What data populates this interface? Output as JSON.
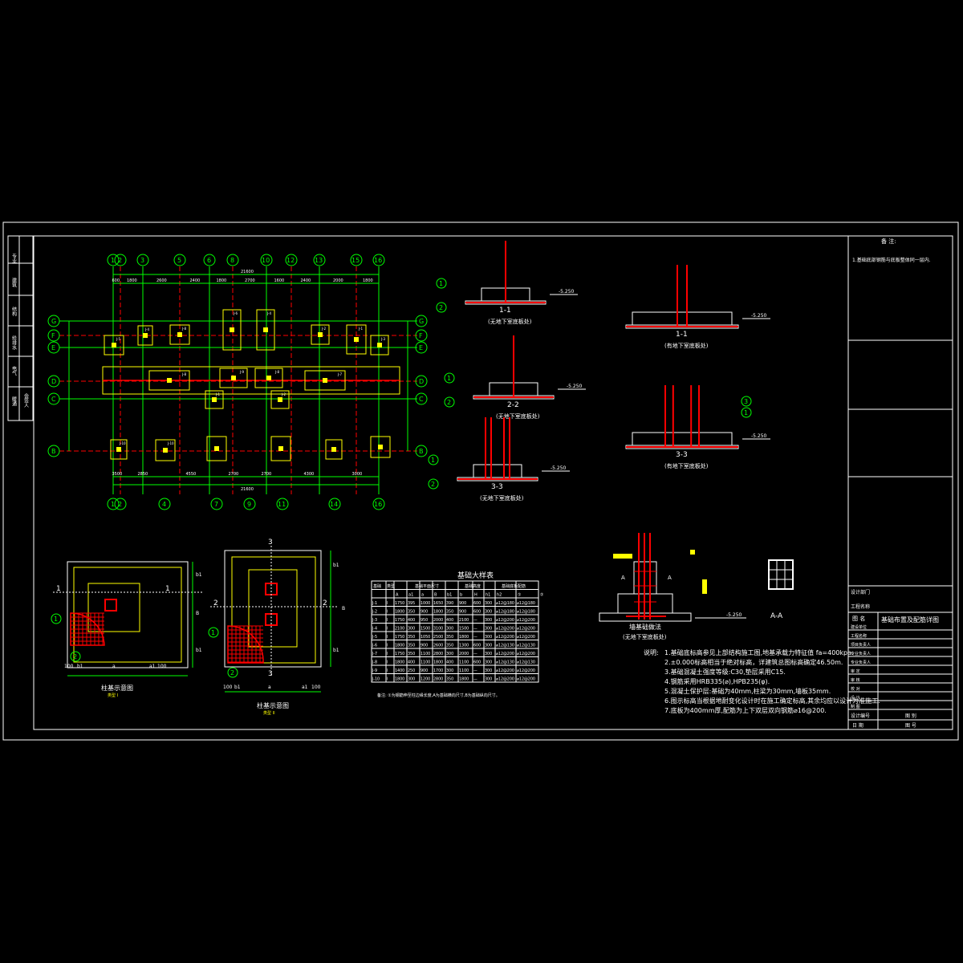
{
  "colors": {
    "background": "#000000",
    "frame": "#ffffff",
    "axis": "#00ff00",
    "dimension": "#00ff00",
    "foundation": "#ffff00",
    "rebar": "#ff0000",
    "text": "#ffffff",
    "annotation": "#00ffff"
  },
  "plan": {
    "top_axes": [
      "1",
      "2",
      "3",
      "5",
      "6",
      "8",
      "10",
      "12",
      "13",
      "15",
      "16"
    ],
    "bottom_axes": [
      "1",
      "2",
      "4",
      "7",
      "9",
      "11",
      "14",
      "16"
    ],
    "row_axes_left": [
      "G",
      "F",
      "E",
      "D",
      "C",
      "B"
    ],
    "row_axes_right": [
      "G",
      "F",
      "E",
      "D",
      "C",
      "B"
    ],
    "top_total": "21600",
    "top_dims": [
      "600",
      "1800",
      "2600",
      "2400",
      "1800",
      "2700",
      "1600",
      "2400",
      "2000",
      "1800"
    ],
    "bottom_total": "21600",
    "bottom_dims": [
      "3500",
      "2850",
      "4550",
      "2700",
      "2700",
      "4300",
      "3000"
    ],
    "footing_tags": [
      "J-5",
      "J-4",
      "J-8",
      "J-6",
      "J-4",
      "J-2",
      "J-1",
      "J-3",
      "J-8",
      "J-9",
      "J-8",
      "J-7",
      "J-1",
      "J-2",
      "J-10",
      "J-10"
    ]
  },
  "sections": [
    {
      "id": "s1a",
      "title": "1-1",
      "caption": "(无地下室底板处)",
      "elev": "-5.250",
      "markers": [
        "1",
        "2"
      ]
    },
    {
      "id": "s1b",
      "title": "1-1",
      "caption": "(有地下室底板处)",
      "elev": "-5.250",
      "markers": []
    },
    {
      "id": "s2",
      "title": "2-2",
      "caption": "(无地下室底板处)",
      "elev": "-5.250",
      "markers": [
        "1",
        "2"
      ]
    },
    {
      "id": "s3a",
      "title": "3-3",
      "caption": "(无地下室底板处)",
      "elev": "-5.250",
      "markers": [
        "1",
        "2"
      ]
    },
    {
      "id": "s3b",
      "title": "3-3",
      "caption": "(有地下室底板处)",
      "elev": "-5.250",
      "markers": [
        "3",
        "1"
      ]
    }
  ],
  "details": {
    "d1": {
      "title": "柱基示意图",
      "sub": "类型 I",
      "cut_label": "1",
      "marker1": "1",
      "marker2": "2",
      "dims": [
        "100",
        "b1",
        "a",
        "a1",
        "100"
      ],
      "side_dims": [
        "b1",
        "B",
        "b1"
      ]
    },
    "d2": {
      "title": "柱基示意图",
      "sub": "类型 II",
      "cut_label": "2",
      "marker1": "1",
      "marker2": "2",
      "cut3": "3",
      "dims": [
        "100",
        "b1",
        "a",
        "a1",
        "100"
      ],
      "side_dims": [
        "b1",
        "B",
        "b1"
      ]
    },
    "beam": {
      "title": "墙基础做法",
      "caption": "(无地下室底板处)",
      "elev": "-5.250",
      "label_a": "A",
      "label_a2": "A"
    },
    "aa": {
      "title": "A-A"
    }
  },
  "table": {
    "title": "基础大样表",
    "group_headers": [
      "基础",
      "类型",
      "基础平面尺寸",
      "基础高度",
      "基础底板配筋"
    ],
    "headers": [
      "A",
      "a1",
      "a",
      "B",
      "b1",
      "b",
      "H",
      "h1",
      "h2",
      "①",
      "②"
    ],
    "rows": [
      [
        "J-1",
        "I",
        "1750",
        "395",
        "1000",
        "1650",
        "390",
        "900",
        "600",
        "300",
        "⌀12@180",
        "⌀12@180"
      ],
      [
        "J-2",
        "I",
        "1800",
        "350",
        "900",
        "1800",
        "350",
        "900",
        "600",
        "300",
        "⌀12@180",
        "⌀12@180"
      ],
      [
        "J-3",
        "I",
        "1750",
        "400",
        "950",
        "2000",
        "400",
        "2100",
        "—",
        "300",
        "⌀12@200",
        "⌀12@200"
      ],
      [
        "J-4",
        "I",
        "2100",
        "300",
        "1500",
        "3100",
        "300",
        "1500",
        "—",
        "300",
        "⌀12@200",
        "⌀12@200"
      ],
      [
        "J-5",
        "I",
        "1750",
        "350",
        "1050",
        "2500",
        "350",
        "1800",
        "—",
        "300",
        "⌀12@200",
        "⌀12@200"
      ],
      [
        "J-6",
        "I",
        "1800",
        "350",
        "900",
        "2600",
        "350",
        "1300",
        "600",
        "300",
        "⌀12@130",
        "⌀12@130"
      ],
      [
        "J-7",
        "I",
        "1750",
        "350",
        "1100",
        "2800",
        "300",
        "2000",
        "—",
        "300",
        "⌀12@200",
        "⌀12@200"
      ],
      [
        "J-8",
        "I",
        "1800",
        "400",
        "1100",
        "1800",
        "400",
        "1100",
        "600",
        "300",
        "⌀12@130",
        "⌀12@130"
      ],
      [
        "J-9",
        "I",
        "1400",
        "250",
        "900",
        "1700",
        "300",
        "1100",
        "—",
        "300",
        "⌀12@200",
        "⌀12@200"
      ],
      [
        "J-10",
        "I",
        "1800",
        "300",
        "1200",
        "2800",
        "350",
        "1800",
        "—",
        "300",
        "⌀12@200",
        "⌀12@200"
      ]
    ],
    "note": "备注: ①为钢筋伸至柱边缘长度,A为基础横向尺寸,B为基础纵向尺寸。"
  },
  "notes": {
    "title": "说明:",
    "items": [
      "1.基础底标高参见上部结构施工图,地基承载力特征值 fa=400kpa.",
      "2.±0.000标高相当于绝对标高，详建筑总图标高确定46.50m.",
      "3.基础混凝土强度等级:C30,垫层采用C15.",
      "4.钢筋采用HRB335(⌀),HPB235(φ).",
      "5.混凝土保护层:基础为40mm,柱梁为30mm,墙板35mm.",
      "6.图示标高当根据地耐变化设计时在施工确定标高,其余均应以设计为准施工.",
      "7.底板为400mm厚,配筋为上下双层双向钢筋⌀16@200."
    ]
  },
  "right_panel": {
    "notes_title": "备 注:",
    "note1": "1.基础底部钢筋与底板整体同一层内.",
    "design_unit": "设计部门",
    "project_label": "工程名称",
    "drawing_label": "图 名",
    "drawing_name": "基础布置及配筋详图",
    "rows": [
      "建设单位",
      "工程名称",
      "项目负责人",
      "专业负责人",
      "专业负责人",
      "审 定",
      "审 核",
      "校 对",
      "设 计",
      "制 图"
    ],
    "foot_left": "设计编号",
    "foot_mid": "图 别",
    "foot_date": "日 期",
    "foot_no": "图 号"
  },
  "left_strip": [
    "专业",
    "建筑",
    "结构",
    "给排水",
    "电气",
    "暖通",
    "会签人"
  ]
}
